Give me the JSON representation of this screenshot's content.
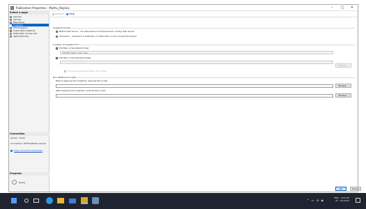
{
  "window": {
    "title": "Publication Properties - Muthu_Replica"
  },
  "left": {
    "select_page": "Select a page",
    "pages": [
      {
        "label": "General",
        "icon": "gear",
        "selected": false
      },
      {
        "label": "Articles",
        "icon": "gear",
        "selected": false
      },
      {
        "label": "Filter Rows",
        "icon": "gear",
        "selected": false
      },
      {
        "label": "Snapshot",
        "icon": "doc",
        "selected": true
      },
      {
        "label": "FTP Snapshot",
        "icon": "doc",
        "selected": false
      },
      {
        "label": "Subscription Options",
        "icon": "doc",
        "selected": false
      },
      {
        "label": "Publication Access List",
        "icon": "user",
        "selected": false
      },
      {
        "label": "Agent Security",
        "icon": "gear",
        "selected": false
      }
    ],
    "connection_head": "Connection",
    "server": "Server: node1",
    "connection": "Connection: MUTHU\\Muthu-kumar",
    "view_props": "View connection properties",
    "progress_head": "Progress",
    "status": "Ready"
  },
  "toolbar": {
    "script": "Script",
    "help": "Help"
  },
  "main": {
    "snapshot_format": "Snapshot format",
    "native": "Native SQL Server - all Subscribers must be servers running SQL Server",
    "character": "Character - required if a Publisher or Subscriber is not running SQL Server",
    "location": "Location of snapshot files",
    "put_default": "Put files in the default folder",
    "default_path": "\\\\NODE1\\Repl_Snap_files",
    "put_following": "Put files in the following folder:",
    "browse": "Browse...",
    "compress": "Compress snapshot files in this folder",
    "run_scripts": "Run additional scripts",
    "before": "Before applying the snapshot, execute this script:",
    "after": "After applying the snapshot, execute this script:"
  },
  "buttons": {
    "ok": "OK",
    "cancel": "Cancel"
  },
  "taskbar": {
    "lang": "ENG",
    "region": "IN",
    "time": "2:01 AM",
    "date": "4/5/2024"
  }
}
